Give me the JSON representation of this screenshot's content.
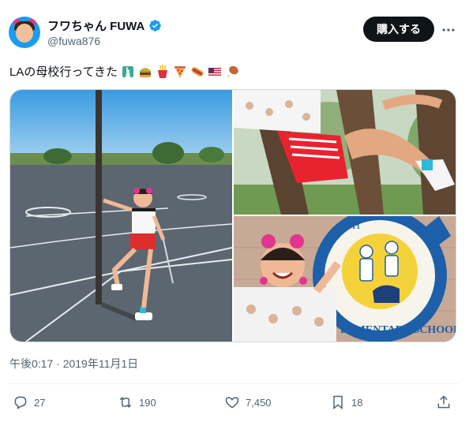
{
  "author": {
    "display_name": "フワちゃん FUWA",
    "handle": "@fuwa876",
    "verified": true,
    "avatar_icon": "avatar-photo"
  },
  "header": {
    "subscribe_label": "購入する",
    "more_icon": "more-dots-icon"
  },
  "tweet": {
    "text": "LAの母校行ってきた",
    "emojis": [
      "statue-of-liberty",
      "hamburger",
      "french-fries",
      "pizza",
      "hot-dog",
      "us-flag",
      "poultry-leg"
    ],
    "timestamp": "午後0:17 · 2019年11月1日"
  },
  "media": {
    "photos": [
      {
        "name": "basketball-court-photo"
      },
      {
        "name": "tree-climb-photo"
      },
      {
        "name": "school-mural-photo"
      }
    ],
    "mural_text": "LEMENTARY SCHOOL",
    "mural_partial": "H"
  },
  "actions": {
    "reply_count": "27",
    "retweet_count": "190",
    "like_count": "7,450",
    "bookmark_count": "18"
  },
  "colors": {
    "brand_blue": "#1d9bf0",
    "text_primary": "#0f1419",
    "text_secondary": "#536471",
    "button_dark": "#0f1419"
  }
}
